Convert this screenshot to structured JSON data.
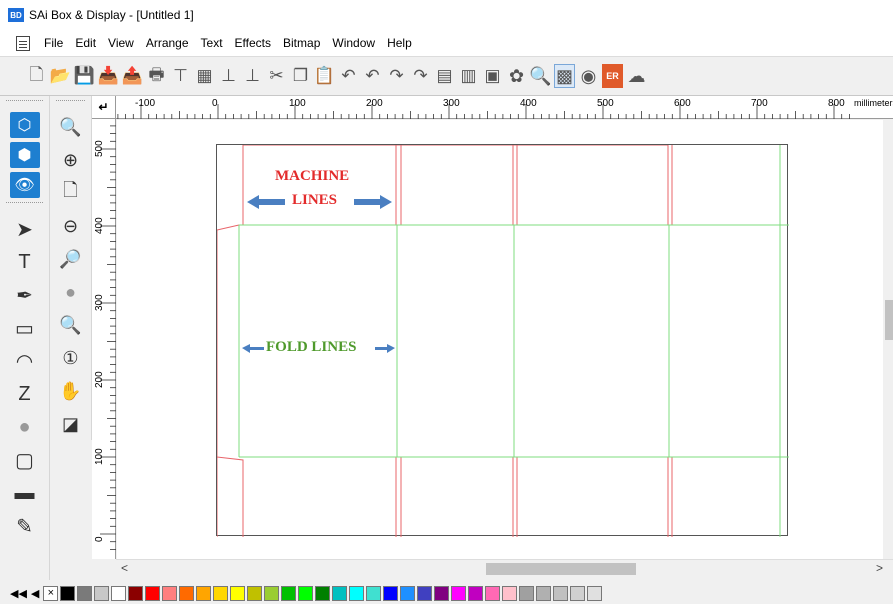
{
  "window": {
    "title": "SAi Box & Display - [Untitled 1]",
    "app_icon_text": "BD"
  },
  "menu": [
    "File",
    "Edit",
    "View",
    "Arrange",
    "Text",
    "Effects",
    "Bitmap",
    "Window",
    "Help"
  ],
  "toolbar_icons": [
    "new-document-icon",
    "open-icon",
    "save-icon",
    "import-icon",
    "export-icon",
    "print-icon",
    "cut-plot-icon",
    "plot-icon",
    "align-icon",
    "weld-icon",
    "scissors-cut-icon",
    "copy-icon",
    "paste-icon",
    "undo-icon",
    "undo-step-icon",
    "redo-icon",
    "redo-step-icon",
    "layers-icon",
    "properties-icon",
    "preview-icon",
    "color-wheel-icon",
    "zoom-color-icon",
    "color-grid-icon",
    "color-layers-icon",
    "er-icon",
    "cloud-icon"
  ],
  "left_tools_col1": [
    "box-3d-icon",
    "box-rotate-icon",
    "eye-icon",
    "select-arrow-icon",
    "text-tool-icon",
    "pen-tool-icon",
    "rectangle-tool-icon",
    "arc-tool-icon",
    "zigzag-tool-icon",
    "fill-blob-icon",
    "frame-icon",
    "ruler-measure-icon",
    "eyedropper-icon"
  ],
  "left_tools_col2": [
    "zoom-fit-icon",
    "zoom-in-icon",
    "zoom-page-icon",
    "zoom-out-icon",
    "zoom-selection-icon",
    "zoom-disabled-icon",
    "zoom-previous-icon",
    "zoom-actual-icon",
    "pan-hand-icon",
    "fill-stroke-icon"
  ],
  "ruler": {
    "unit": "millimeters",
    "h_labels": [
      "-100",
      "0",
      "100",
      "200",
      "300",
      "400",
      "500",
      "600",
      "700",
      "800"
    ],
    "v_labels": [
      "500",
      "400",
      "300",
      "200",
      "100",
      "0"
    ]
  },
  "annotations": {
    "machine_line1": "MACHINE",
    "machine_line2": "LINES",
    "fold": "FOLD LINES"
  },
  "colors": {
    "cut_line": "#e8646a",
    "fold_line": "#7fdc7f",
    "annotation_red": "#e32b2b",
    "annotation_green": "#4f9a2c",
    "arrow_blue": "#4a7fc1"
  },
  "palette": [
    "#ffffff",
    "#000000",
    "#7a7a7a",
    "#c8c8c8",
    "#ffffff",
    "#8b0000",
    "#ff0000",
    "#ff7f7f",
    "#ff6a00",
    "#ffa500",
    "#ffd700",
    "#ffff00",
    "#c0c000",
    "#9acd32",
    "#00c000",
    "#00ff00",
    "#008000",
    "#00c0c0",
    "#00ffff",
    "#40e0d0",
    "#0000ff",
    "#1e90ff",
    "#4040c0",
    "#800080",
    "#ff00ff",
    "#c000c0",
    "#ff69b4",
    "#ffc0cb",
    "#a0a0a0",
    "#b0b0b0",
    "#c0c0c0",
    "#d0d0d0",
    "#e0e0e0"
  ]
}
